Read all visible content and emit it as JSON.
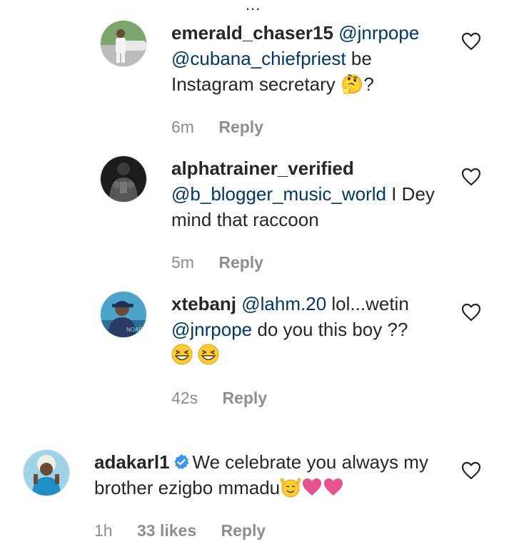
{
  "top_more_glyph": "...",
  "comments": [
    {
      "username": "emerald_chaser15",
      "mentions": [
        "@jnrpope",
        "@cubana_chiefpriest"
      ],
      "text_after": " be Instagram secretary 🤔?",
      "time": "6m",
      "reply_label": "Reply",
      "avatar_icon": "profile-photo-man-in-white-by-car",
      "like_icon": "heart-outline-icon"
    },
    {
      "username": "alphatrainer_verified",
      "mentions": [
        "@b_blogger_music_world"
      ],
      "text_after": " I Dey mind that raccoon",
      "time": "5m",
      "reply_label": "Reply",
      "avatar_icon": "profile-photo-muscular-man-dark",
      "like_icon": "heart-outline-icon"
    },
    {
      "username": "xtebanj",
      "mentions": [
        "@lahm.20",
        "@jnrpope"
      ],
      "text_mid": " lol...wetin ",
      "text_after": " do you this boy ??",
      "emojis": [
        "grinning-squinting-face",
        "grinning-squinting-face"
      ],
      "time": "42s",
      "reply_label": "Reply",
      "avatar_icon": "profile-photo-man-with-cap",
      "like_icon": "heart-outline-icon"
    },
    {
      "username": "adakarl1",
      "verified": true,
      "text": "We celebrate you always my brother ezigbo mmadu",
      "emojis": [
        "smiling-face-with-raised-hands",
        "pink-heart",
        "pink-heart"
      ],
      "time": "1h",
      "likes": "33 likes",
      "reply_label": "Reply",
      "avatar_icon": "profile-photo-woman-blonde-hair",
      "like_icon": "heart-outline-icon"
    }
  ],
  "colors": {
    "text": "#262626",
    "mention": "#00376b",
    "meta": "#8e8e8e",
    "verified": "#3897f0",
    "emoji_yellow": "#ffcc33",
    "emoji_heart": "#e8538f"
  }
}
